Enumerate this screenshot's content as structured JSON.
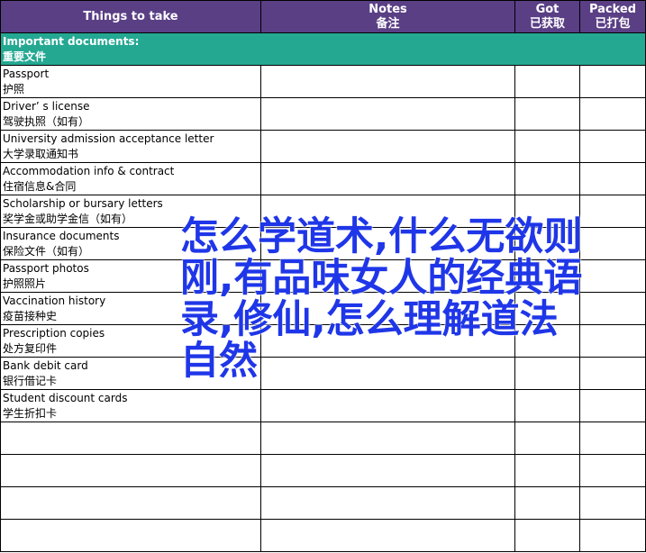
{
  "header": {
    "col1": "Things to take",
    "col2_en": "Notes",
    "col2_zh": "备注",
    "col3_en": "Got",
    "col3_zh": "已获取",
    "col4_en": "Packed",
    "col4_zh": "已打包"
  },
  "section": {
    "en": "Important documents:",
    "zh": "重要文件"
  },
  "items": [
    {
      "en": "Passport",
      "zh": "护照"
    },
    {
      "en": "Driver’ s license",
      "zh": "驾驶执照（如有）"
    },
    {
      "en": "University admission acceptance letter",
      "zh": "大学录取通知书"
    },
    {
      "en": "Accommodation info & contract",
      "zh": "住宿信息&合同"
    },
    {
      "en": "Scholarship or bursary letters",
      "zh": "奖学金或助学金信（如有）"
    },
    {
      "en": "Insurance documents",
      "zh": "保险文件（如有）"
    },
    {
      "en": "Passport photos",
      "zh": "护照照片"
    },
    {
      "en": "Vaccination history",
      "zh": "疫苗接种史"
    },
    {
      "en": "Prescription copies",
      "zh": "处方复印件"
    },
    {
      "en": "Bank debit card",
      "zh": "银行借记卡"
    },
    {
      "en": "Student discount cards",
      "zh": "学生折扣卡"
    }
  ],
  "overlay_text": "怎么学道术,什么无欲则刚,有品味女人的经典语录,修仙,怎么理解道法自然",
  "colors": {
    "header": "#5a3f85",
    "section": "#24a892",
    "overlay": "#1f36e8"
  }
}
